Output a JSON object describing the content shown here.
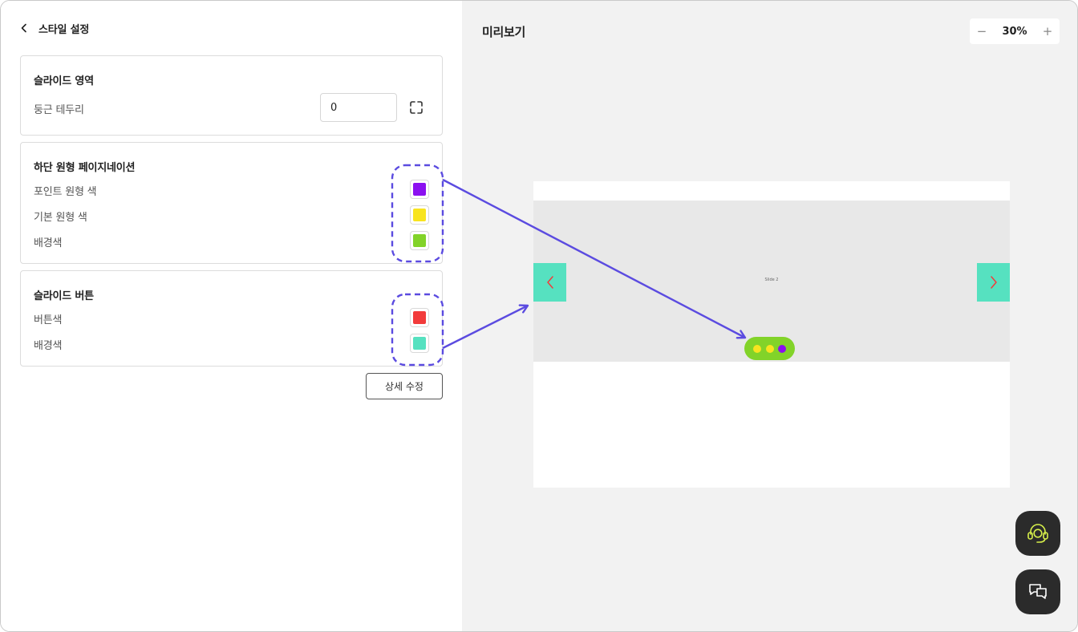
{
  "header": {
    "back_title": "스타일 설정"
  },
  "slide_area": {
    "title": "슬라이드 영역",
    "radius_label": "둥근 테두리",
    "radius_value": "0"
  },
  "pagination": {
    "title": "하단 원형 페이지네이션",
    "rows": [
      {
        "label": "포인트 원형 색",
        "color": "#8b10f0"
      },
      {
        "label": "기본 원형 색",
        "color": "#f8e41f"
      },
      {
        "label": "배경색",
        "color": "#82d329"
      }
    ]
  },
  "slide_button": {
    "title": "슬라이드 버튼",
    "rows": [
      {
        "label": "버튼색",
        "color": "#f23b3b"
      },
      {
        "label": "배경색",
        "color": "#56e1c0"
      }
    ]
  },
  "detail_edit_label": "상세 수정",
  "preview": {
    "title": "미리보기",
    "zoom": "30%",
    "zoom_minus": "−",
    "zoom_plus": "+",
    "slide_text": "Slide 2",
    "pager_colors": [
      "#f8e41f",
      "#f8e41f",
      "#8b10f0"
    ]
  },
  "colors": {
    "annotation": "#5b4be0",
    "fab_bg": "#2b2b2b",
    "fab_icon": "#d7f04a"
  }
}
